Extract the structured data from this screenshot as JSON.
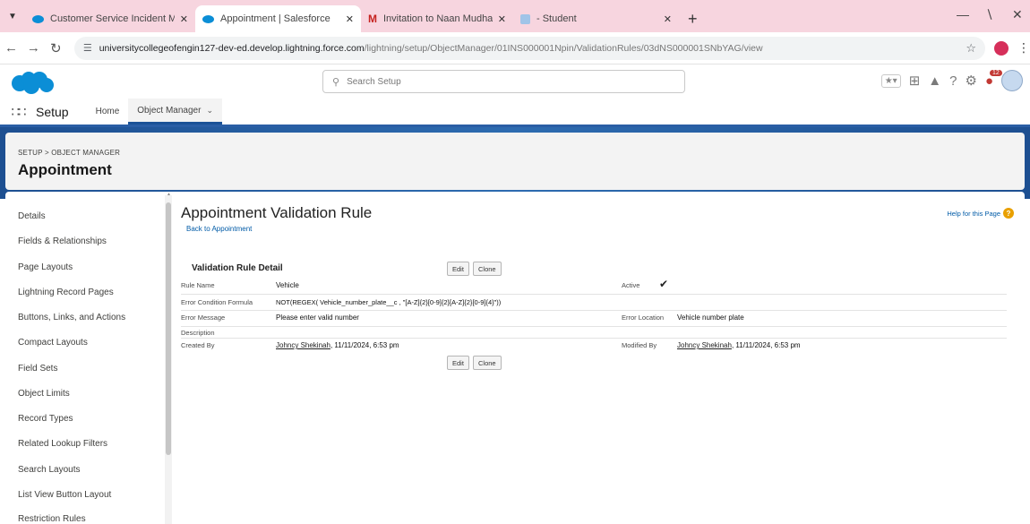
{
  "browser": {
    "tabs": [
      {
        "title": "Customer Service Incident Ma",
        "icon": "salesforce-cloud-icon",
        "active": false
      },
      {
        "title": "Appointment | Salesforce",
        "icon": "salesforce-cloud-icon",
        "active": true
      },
      {
        "title": "Invitation to Naan Mudhalvan",
        "icon": "gmail-icon",
        "active": false
      },
      {
        "title": "- Student",
        "icon": "document-icon",
        "active": false
      }
    ],
    "url_host": "universitycollegeofengin127-dev-ed.develop.lightning.force.com",
    "url_path": "/lightning/setup/ObjectManager/01INS000001Npin/ValidationRules/03dNS000001SNbYAG/view"
  },
  "header": {
    "search_placeholder": "Search Setup",
    "notification_count": "12"
  },
  "appnav": {
    "app_name": "Setup",
    "items": [
      {
        "label": "Home"
      },
      {
        "label": "Object Manager"
      }
    ]
  },
  "object_header": {
    "breadcrumb": "SETUP > OBJECT MANAGER",
    "title": "Appointment"
  },
  "sidebar": {
    "items": [
      "Details",
      "Fields & Relationships",
      "Page Layouts",
      "Lightning Record Pages",
      "Buttons, Links, and Actions",
      "Compact Layouts",
      "Field Sets",
      "Object Limits",
      "Record Types",
      "Related Lookup Filters",
      "Search Layouts",
      "List View Button Layout",
      "Restriction Rules"
    ]
  },
  "content": {
    "title": "Appointment Validation Rule",
    "back_link": "Back to Appointment",
    "help_link": "Help for this Page",
    "detail_title": "Validation Rule Detail",
    "edit_label": "Edit",
    "clone_label": "Clone",
    "fields": {
      "rule_name_label": "Rule Name",
      "rule_name": "Vehicle",
      "active_label": "Active",
      "formula_label": "Error Condition Formula",
      "formula": "NOT(REGEX( Vehicle_number_plate__c , \"[A-Z]{2}[0-9]{2}[A-Z]{2}[0-9]{4}\"))",
      "error_message_label": "Error Message",
      "error_message": "Please enter valid number",
      "error_location_label": "Error Location",
      "error_location": "Vehicle number plate",
      "description_label": "Description",
      "created_by_label": "Created By",
      "created_by_user": "Johncy Shekinah",
      "created_date": ", 11/11/2024, 6:53 pm",
      "modified_by_label": "Modified By",
      "modified_by_user": "Johncy Shekinah",
      "modified_date": ", 11/11/2024, 6:53 pm"
    }
  }
}
